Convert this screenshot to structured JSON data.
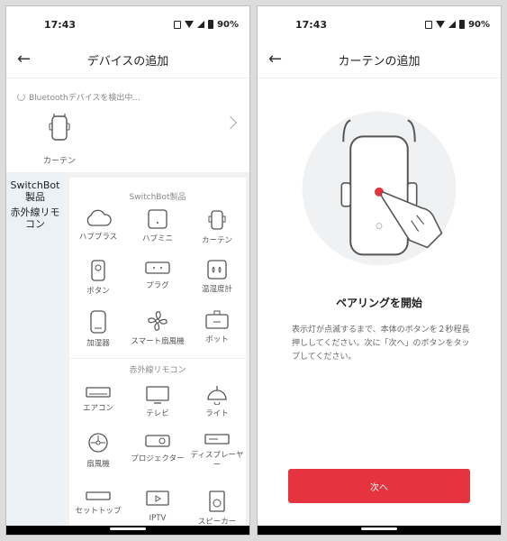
{
  "left": {
    "status": {
      "time": "17:43",
      "battery": "90%"
    },
    "appbar": {
      "title": "デバイスの追加"
    },
    "scan": {
      "status_text": "Bluetoothデバイスを検出中...",
      "found_device": "カーテン"
    },
    "sidenav": [
      "SwitchBot製品",
      "赤外線リモコン"
    ],
    "switchbot_section": {
      "title": "SwitchBot製品",
      "items": [
        {
          "label": "ハブプラス",
          "icon": "cloud-icon"
        },
        {
          "label": "ハブミニ",
          "icon": "hub-mini-icon"
        },
        {
          "label": "カーテン",
          "icon": "curtain-icon"
        },
        {
          "label": "ボタン",
          "icon": "button-icon"
        },
        {
          "label": "プラグ",
          "icon": "plug-icon"
        },
        {
          "label": "温湿度計",
          "icon": "thermometer-icon"
        },
        {
          "label": "加湿器",
          "icon": "humidifier-icon"
        },
        {
          "label": "スマート扇風機",
          "icon": "smart-fan-icon"
        },
        {
          "label": "ボット",
          "icon": "bot-icon"
        }
      ]
    },
    "ir_section": {
      "title": "赤外線リモコン",
      "items": [
        {
          "label": "エアコン",
          "icon": "aircon-icon"
        },
        {
          "label": "テレビ",
          "icon": "tv-icon"
        },
        {
          "label": "ライト",
          "icon": "light-icon"
        },
        {
          "label": "扇風機",
          "icon": "fan-icon"
        },
        {
          "label": "プロジェクター",
          "icon": "projector-icon"
        },
        {
          "label": "ディスプレーヤー",
          "icon": "disc-player-icon"
        },
        {
          "label": "セットトップ",
          "icon": "set-top-box-icon"
        },
        {
          "label": "IPTV",
          "icon": "iptv-icon"
        },
        {
          "label": "スピーカー",
          "icon": "speaker-icon"
        }
      ]
    }
  },
  "right": {
    "status": {
      "time": "17:43",
      "battery": "90%"
    },
    "appbar": {
      "title": "カーテンの追加"
    },
    "pairing_title": "ペアリングを開始",
    "pairing_desc": "表示灯が点滅するまで、本体のボタンを２秒程長押ししてください。次に「次へ」のボタンをタップしてください。",
    "next_button": "次へ"
  },
  "colors": {
    "accent": "#e5333f",
    "sidebar_bg": "#eaf2f7",
    "muted_text": "#888888"
  }
}
